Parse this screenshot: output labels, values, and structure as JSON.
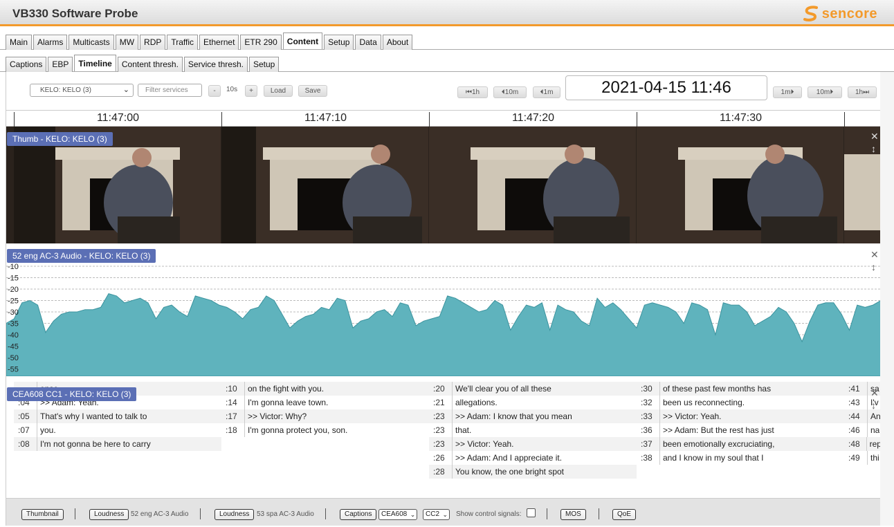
{
  "app": {
    "title": "VB330 Software Probe",
    "logo_text": "sencore",
    "accent": "#f39a2b"
  },
  "main_tabs": [
    "Main",
    "Alarms",
    "Multicasts",
    "MW",
    "RDP",
    "Traffic",
    "Ethernet",
    "ETR 290",
    "Content",
    "Setup",
    "Data",
    "About"
  ],
  "main_tab_active": "Content",
  "sub_tabs": [
    "Captions",
    "EBP",
    "Timeline",
    "Content thresh.",
    "Service thresh.",
    "Setup"
  ],
  "sub_tab_active": "Timeline",
  "toolbar": {
    "service_select": "KELO: KELO (3)",
    "filter_placeholder": "Filter services",
    "minus": "-",
    "zoom": "10s",
    "plus": "+",
    "load": "Load",
    "save": "Save",
    "back_1h": "1h",
    "back_10m": "10m",
    "back_1m": "1m",
    "datetime": "2021-04-15 11:46",
    "fwd_1m": "1m",
    "fwd_10m": "10m",
    "fwd_1h": "1h"
  },
  "time_labels": [
    "11:47:00",
    "11:47:10",
    "11:47:20",
    "11:47:30"
  ],
  "thumb_track_label": "Thumb - KELO: KELO (3)",
  "audio_track_label": "52 eng AC-3 Audio - KELO: KELO (3)",
  "audio_axis": [
    "-10",
    "-15",
    "-20",
    "-25",
    "-30",
    "-35",
    "-40",
    "-45",
    "-50",
    "-55"
  ],
  "audio_color": "#5fb3bd",
  "audio_levels_db": [
    -35,
    -33,
    -26,
    -25,
    -27,
    -39,
    -34,
    -31,
    -30,
    -30,
    -29,
    -29,
    -28,
    -22,
    -23,
    -26,
    -25,
    -24,
    -26,
    -33,
    -28,
    -27,
    -30,
    -32,
    -23,
    -24,
    -25,
    -27,
    -28,
    -30,
    -33,
    -29,
    -28,
    -23,
    -25,
    -31,
    -37,
    -34,
    -32,
    -31,
    -28,
    -29,
    -24,
    -25,
    -37,
    -34,
    -33,
    -30,
    -29,
    -32,
    -26,
    -27,
    -36,
    -34,
    -33,
    -32,
    -23,
    -24,
    -26,
    -28,
    -30,
    -29,
    -25,
    -27,
    -38,
    -32,
    -27,
    -28,
    -26,
    -38,
    -27,
    -29,
    -30,
    -34,
    -36,
    -24,
    -28,
    -26,
    -29,
    -33,
    -37,
    -27,
    -26,
    -27,
    -28,
    -30,
    -35,
    -26,
    -27,
    -29,
    -40,
    -26,
    -27,
    -27,
    -30,
    -36,
    -34,
    -32,
    -28,
    -30,
    -35,
    -43,
    -34,
    -27,
    -26,
    -26,
    -31,
    -38,
    -27,
    -28,
    -27,
    -25
  ],
  "caption_track_label": "CEA608 CC1 - KELO: KELO (3)",
  "caption_columns": [
    [
      {
        "t": "",
        "s": "ense."
      },
      {
        "t": ":04",
        "s": ">> Adam: Yeah."
      },
      {
        "t": ":05",
        "s": "That's why I wanted to talk to"
      },
      {
        "t": ":07",
        "s": "you."
      },
      {
        "t": ":08",
        "s": "I'm not gonna be here to carry"
      }
    ],
    [
      {
        "t": ":10",
        "s": "on the fight with you."
      },
      {
        "t": ":14",
        "s": "I'm gonna leave town."
      },
      {
        "t": ":17",
        "s": ">> Victor: Why?"
      },
      {
        "t": ":18",
        "s": "I'm gonna protect you, son."
      }
    ],
    [
      {
        "t": ":20",
        "s": "We'll clear you of all these"
      },
      {
        "t": ":21",
        "s": "allegations."
      },
      {
        "t": ":23",
        "s": ">> Adam: I know that you mean"
      },
      {
        "t": ":23",
        "s": "that."
      },
      {
        "t": ":23",
        "s": ">> Victor: Yeah."
      },
      {
        "t": ":26",
        "s": ">> Adam: And I appreciate it."
      },
      {
        "t": ":28",
        "s": "You know, the one bright spot"
      }
    ],
    [
      {
        "t": ":30",
        "s": "of these past few months has"
      },
      {
        "t": ":32",
        "s": "been us reconnecting."
      },
      {
        "t": ":33",
        "s": ">> Victor: Yeah."
      },
      {
        "t": ":36",
        "s": ">> Adam: But the rest has just"
      },
      {
        "t": ":37",
        "s": "been emotionally excruciating,"
      },
      {
        "t": ":38",
        "s": "and I know in my soul that I"
      }
    ],
    [
      {
        "t": ":41",
        "s": "sa"
      },
      {
        "t": ":43",
        "s": "I'v"
      },
      {
        "t": ":44",
        "s": "An"
      },
      {
        "t": ":46",
        "s": "na"
      },
      {
        "t": ":48",
        "s": "rep"
      },
      {
        "t": ":49",
        "s": "thi"
      }
    ]
  ],
  "bottom": {
    "thumbnail": "Thumbnail",
    "loudness1": "Loudness",
    "loudness1_desc": "52 eng AC-3 Audio",
    "loudness2": "Loudness",
    "loudness2_desc": "53 spa AC-3 Audio",
    "captions": "Captions",
    "cea": "CEA608",
    "cc": "CC2",
    "show_control": "Show control signals:",
    "mos": "MOS",
    "qoe": "QoE"
  }
}
